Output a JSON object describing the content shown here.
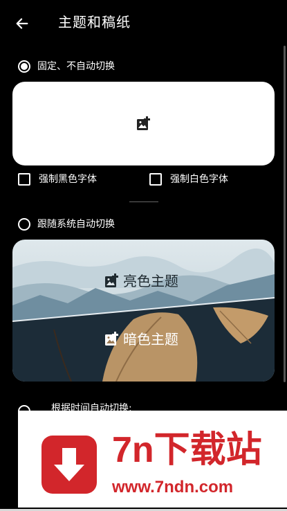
{
  "header": {
    "title": "主题和稿纸",
    "back_icon": "arrow-left-icon"
  },
  "options": {
    "fixed": {
      "label": "固定、不自动切换",
      "selected": true
    },
    "follow_system": {
      "label": "跟随系统自动切换",
      "selected": false
    },
    "by_time": {
      "label": "根据时间自动切换:",
      "selected": false
    }
  },
  "fixed_card": {
    "icon": "add-image-icon"
  },
  "checkboxes": [
    {
      "label": "强制黑色字体",
      "checked": false
    },
    {
      "label": "强制白色字体",
      "checked": false
    }
  ],
  "theme_card": {
    "light_label": "亮色主题",
    "dark_label": "暗色主题",
    "light_icon": "add-image-icon",
    "dark_icon": "add-image-icon"
  },
  "ad": {
    "title": "7n下载站",
    "url": "www.7ndn.com",
    "brand_color": "#d2262b"
  }
}
